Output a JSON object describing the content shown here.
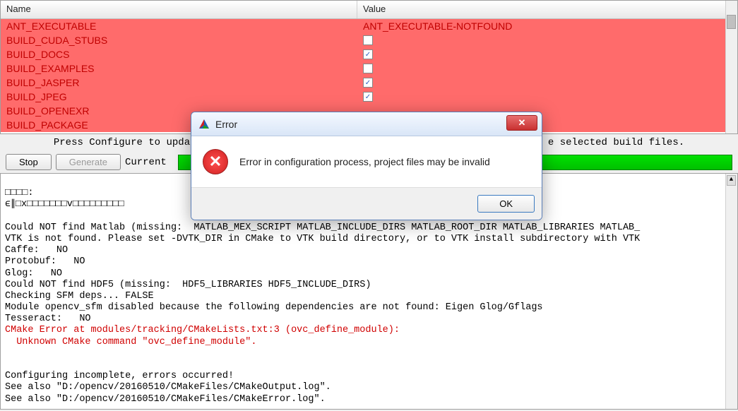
{
  "table": {
    "headers": {
      "name": "Name",
      "value": "Value"
    },
    "rows": [
      {
        "name": "ANT_EXECUTABLE",
        "value": "ANT_EXECUTABLE-NOTFOUND",
        "type": "text"
      },
      {
        "name": "BUILD_CUDA_STUBS",
        "value": false,
        "type": "checkbox"
      },
      {
        "name": "BUILD_DOCS",
        "value": true,
        "type": "checkbox"
      },
      {
        "name": "BUILD_EXAMPLES",
        "value": false,
        "type": "checkbox"
      },
      {
        "name": "BUILD_JASPER",
        "value": true,
        "type": "checkbox"
      },
      {
        "name": "BUILD_JPEG",
        "value": true,
        "type": "checkbox"
      },
      {
        "name": "BUILD_OPENEXR",
        "value": null,
        "type": "checkbox"
      },
      {
        "name": "BUILD_PACKAGE",
        "value": null,
        "type": "checkbox"
      }
    ]
  },
  "status_line_left": "Press Configure to upda",
  "status_line_right": "e selected build files.",
  "buttons": {
    "stop": "Stop",
    "generate": "Generate",
    "current_label": "Current"
  },
  "log": {
    "line1": "□□□□:",
    "line2": "ϵ∥□x□□□□□□□v□□□□□□□□□",
    "msg1": "Could NOT find Matlab (missing:  MATLAB_MEX_SCRIPT MATLAB_INCLUDE_DIRS MATLAB_ROOT_DIR MATLAB_LIBRARIES MATLAB_",
    "msg2": "VTK is not found. Please set -DVTK_DIR in CMake to VTK build directory, or to VTK install subdirectory with VTK",
    "msg3": "Caffe:   NO",
    "msg4": "Protobuf:   NO",
    "msg5": "Glog:   NO",
    "msg6": "Could NOT find HDF5 (missing:  HDF5_LIBRARIES HDF5_INCLUDE_DIRS)",
    "msg7": "Checking SFM deps... FALSE",
    "msg8": "Module opencv_sfm disabled because the following dependencies are not found: Eigen Glog/Gflags",
    "msg9": "Tesseract:   NO",
    "err1": "CMake Error at modules/tracking/CMakeLists.txt:3 (ovc_define_module):",
    "err2": "  Unknown CMake command \"ovc_define_module\".",
    "msg10": "Configuring incomplete, errors occurred!",
    "msg11": "See also \"D:/opencv/20160510/CMakeFiles/CMakeOutput.log\".",
    "msg12": "See also \"D:/opencv/20160510/CMakeFiles/CMakeError.log\"."
  },
  "dialog": {
    "title": "Error",
    "message": "Error in configuration process, project files may be invalid",
    "ok": "OK"
  }
}
